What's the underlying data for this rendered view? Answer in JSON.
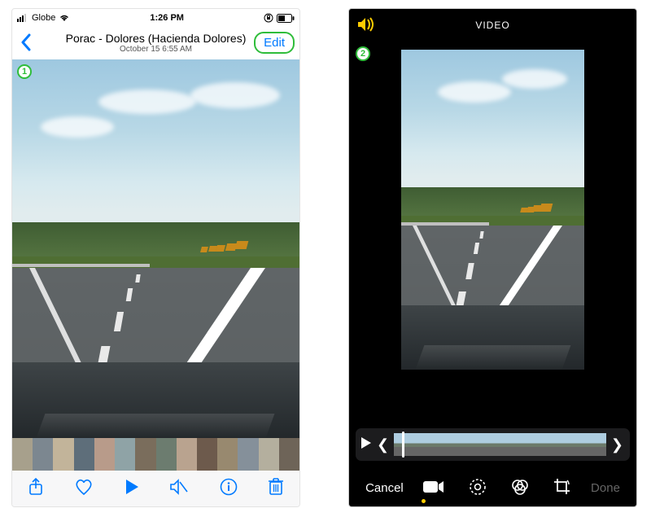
{
  "left": {
    "status": {
      "carrier": "Globe",
      "time": "1:26 PM"
    },
    "nav": {
      "title": "Porac - Dolores (Hacienda Dolores)",
      "subtitle": "October 15  6:55 AM",
      "edit_label": "Edit"
    },
    "step_badge": "1",
    "toolbar_icons": {
      "share": "share-icon",
      "favorite": "heart-icon",
      "play": "play-icon",
      "mute": "speaker-mute-icon",
      "info": "info-icon",
      "trash": "trash-icon"
    }
  },
  "right": {
    "header_title": "VIDEO",
    "step_badge": "2",
    "footer": {
      "cancel": "Cancel",
      "done": "Done"
    },
    "edit_tabs": {
      "video": "video-icon",
      "adjust": "adjust-icon",
      "filters": "filters-icon",
      "crop": "crop-icon"
    }
  }
}
